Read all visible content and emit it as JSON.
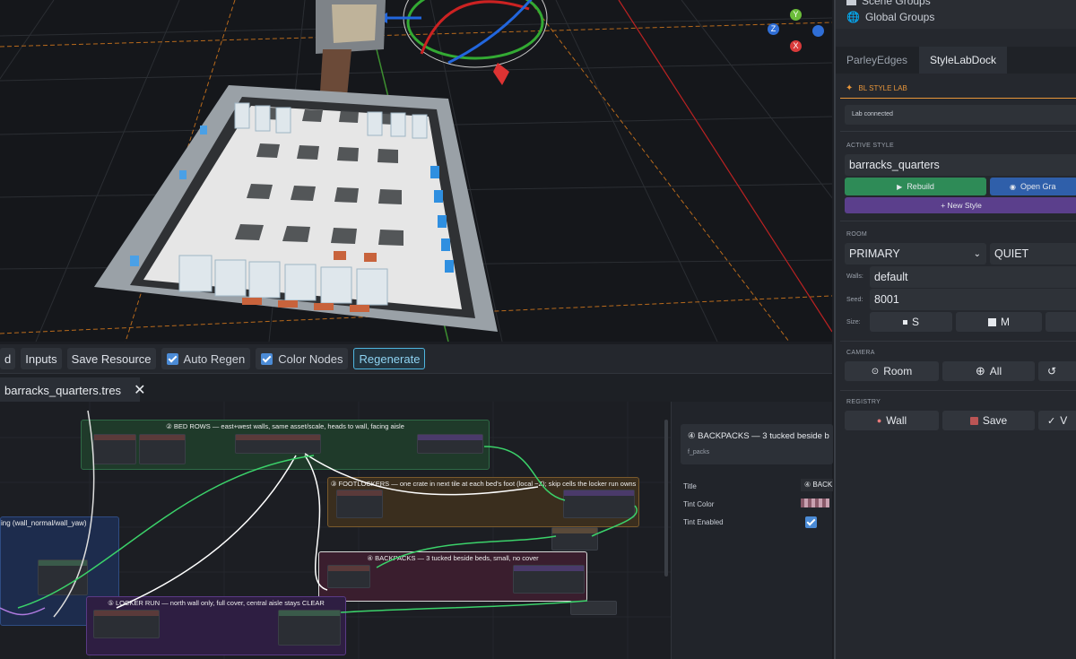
{
  "scene_tree": {
    "items": [
      {
        "label": "Scene Groups"
      },
      {
        "label": "Global Groups"
      }
    ]
  },
  "dock_tabs": [
    {
      "label": "ParleyEdges"
    },
    {
      "label": "StyleLabDock"
    }
  ],
  "style_lab": {
    "header": "BL STYLE LAB",
    "status": "Lab connected",
    "active_style_label": "ACTIVE STYLE",
    "active_style_value": "barracks_quarters",
    "rebuild_label": "Rebuild",
    "open_graph_label": "Open Gra",
    "new_style_label": "+ New Style",
    "room_label": "ROOM",
    "room_type": "PRIMARY",
    "room_mood": "QUIET",
    "walls_label": "Walls:",
    "walls_value": "default",
    "seed_label": "Seed:",
    "seed_value": "8001",
    "size_label": "Size:",
    "size_s": "S",
    "size_m": "M",
    "camera_label": "CAMERA",
    "camera_room": "Room",
    "camera_all": "All",
    "registry_label": "REGISTRY",
    "registry_wall": "Wall",
    "registry_save": "Save",
    "registry_v": "V"
  },
  "toolbar": {
    "partial_label": "d",
    "inputs_label": "Inputs",
    "save_resource_label": "Save Resource",
    "auto_regen_label": "Auto Regen",
    "color_nodes_label": "Color Nodes",
    "regenerate_label": "Regenerate"
  },
  "file_tab": {
    "label": "barracks_quarters.tres"
  },
  "graph_frames": {
    "bed_rows": "② BED ROWS — east+west walls, same asset/scale, heads to wall, facing aisle",
    "footlockers": "③ FOOTLOCKERS — one crate in next tile at each bed's foot (local −Z); skip cells the locker run owns",
    "backpacks": "④ BACKPACKS — 3 tucked beside beds, small, no cover",
    "locker_run": "⑤ LOCKER RUN — north wall only, full cover, central aisle stays CLEAR",
    "wall_frame": "ing (wall_normal/wall_yaw)"
  },
  "inspector": {
    "title_header": "④ BACKPACKS — 3 tucked beside b",
    "subtitle": "f_packs",
    "title_label": "Title",
    "title_value": "④ BACK",
    "tint_color_label": "Tint Color",
    "tint_enabled_label": "Tint Enabled"
  },
  "colors": {
    "accent_orange": "#e8963a",
    "rebuild_green": "#2e8b57",
    "open_blue": "#2f5faa",
    "new_style_purple": "#5b3f8c",
    "regen_cyan": "#4fb6e0"
  }
}
